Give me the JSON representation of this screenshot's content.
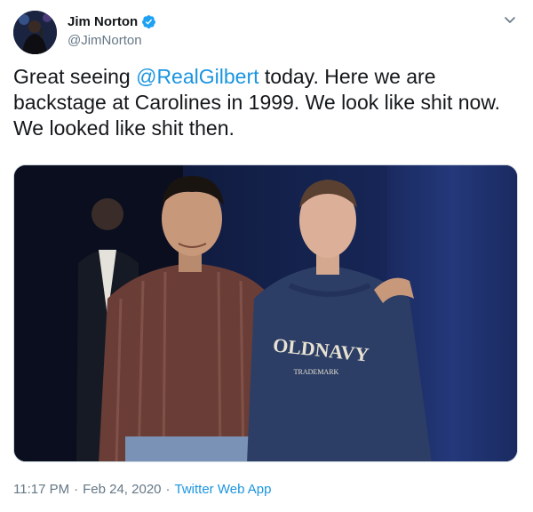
{
  "author": {
    "display_name": "Jim Norton",
    "handle": "@JimNorton",
    "verified": true,
    "avatar_icon": "avatar-photo",
    "verified_icon": "verified-badge-icon",
    "verified_color": "#1da1f2"
  },
  "menu": {
    "icon": "chevron-down-icon"
  },
  "tweet": {
    "text_before": "Great seeing ",
    "mention": "@RealGilbert",
    "text_after": " today. Here we are backstage at Carolines in 1999. We look like shit now. We looked like shit then.",
    "mention_color": "#1b95e0"
  },
  "photo": {
    "sweatshirt_logo": "OLDNAVY",
    "sweatshirt_sub": "TRADEMARK"
  },
  "meta": {
    "time": "11:17 PM",
    "separator": "·",
    "date": "Feb 24, 2020",
    "source": "Twitter Web App"
  }
}
